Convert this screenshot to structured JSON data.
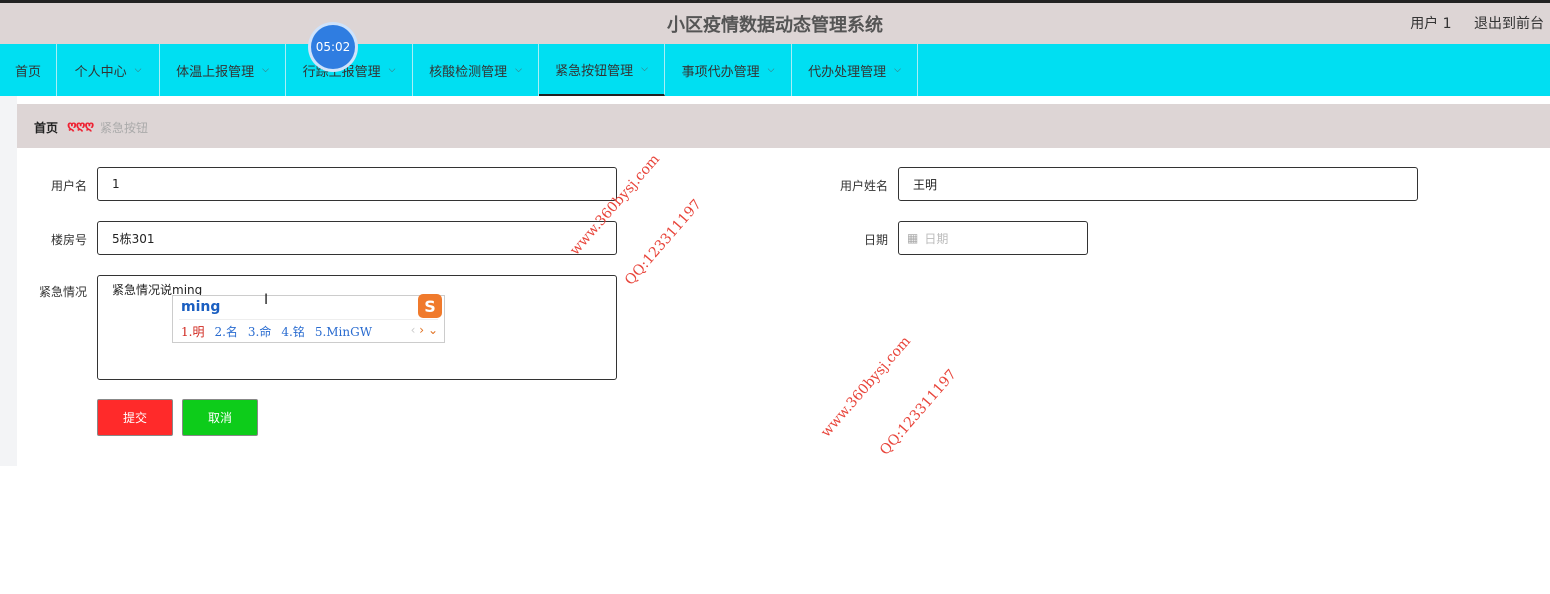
{
  "header": {
    "title": "小区疫情数据动态管理系统",
    "user": "用户 1",
    "exit": "退出到前台"
  },
  "timer": "05:02",
  "nav": {
    "items": [
      {
        "label": "首页"
      },
      {
        "label": "个人中心"
      },
      {
        "label": "体温上报管理"
      },
      {
        "label": "行踪上报管理"
      },
      {
        "label": "核酸检测管理"
      },
      {
        "label": "紧急按钮管理"
      },
      {
        "label": "事项代办管理"
      },
      {
        "label": "代办处理管理"
      }
    ],
    "active": "紧急按钮管理"
  },
  "breadcrumb": {
    "home": "首页",
    "separator": "ღღღ",
    "current": "紧急按钮"
  },
  "form": {
    "username_label": "用户名",
    "username_value": "1",
    "fullname_label": "用户姓名",
    "fullname_value": "王明",
    "building_label": "楼房号",
    "building_value": "5栋301",
    "date_label": "日期",
    "date_placeholder": "日期",
    "emergency_label": "紧急情况",
    "emergency_value": "紧急情况说ming",
    "submit_label": "提交",
    "cancel_label": "取消"
  },
  "ime": {
    "composition": "ming",
    "candidates": [
      "1.明",
      "2.名",
      "3.命",
      "4.铭",
      "5.MinGW"
    ],
    "logo": "S"
  },
  "watermarks": {
    "site": "www.360bysj.com",
    "qq": "QQ:123311197"
  },
  "colors": {
    "nav_bg": "#00dff2",
    "header_bg": "#ddd5d5",
    "submit_bg": "#ff2a2a",
    "cancel_bg": "#0dcc1a"
  }
}
